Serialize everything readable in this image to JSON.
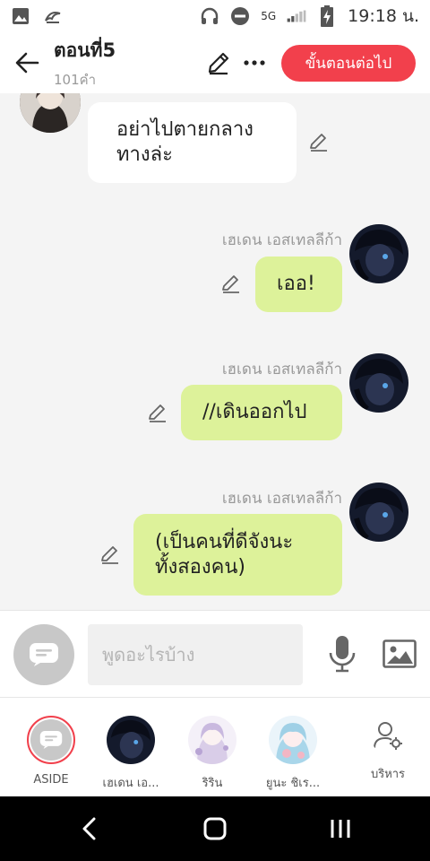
{
  "status_bar": {
    "network": "5G",
    "time": "19:18 น."
  },
  "header": {
    "title": "ตอนที่5",
    "word_count": "101คำ",
    "next_button": "ขั้นตอนต่อไป"
  },
  "messages": [
    {
      "text": "อย่าไปตายกลาง\nทางล่ะ",
      "side": "left"
    },
    {
      "speaker": "เฮเดน เอสเทลลีก้า",
      "text": "เออ!",
      "side": "right"
    },
    {
      "speaker": "เฮเดน เอสเทลลีก้า",
      "text": "//เดินออกไป",
      "side": "right"
    },
    {
      "speaker": "เฮเดน เอสเทลลีก้า",
      "text": "(เป็นคนที่ดีจังนะ\nทั้งสองคน)",
      "side": "right"
    }
  ],
  "input": {
    "placeholder": "พูดอะไรบ้าง"
  },
  "characters": [
    {
      "name": "ASIDE"
    },
    {
      "name": "เฮเดน เอ..."
    },
    {
      "name": "ริริน"
    },
    {
      "name": "ยูนะ ชิเร..."
    },
    {
      "name": "บริหาร"
    }
  ],
  "colors": {
    "accent": "#f2404c",
    "own_bubble": "#ddf29a",
    "other_bubble": "#ffffff",
    "background": "#f4f4f4"
  }
}
